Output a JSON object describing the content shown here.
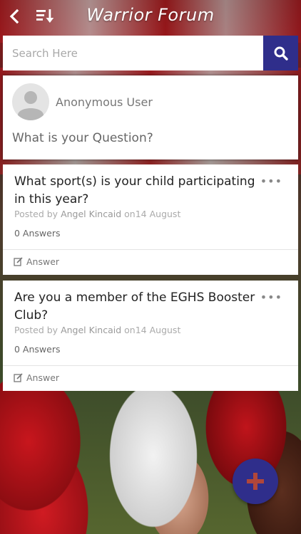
{
  "header": {
    "title": "Warrior Forum",
    "back_icon": "back-arrow-icon",
    "sort_icon": "sort-icon"
  },
  "search": {
    "placeholder": "Search Here",
    "value": "",
    "button_icon": "search-icon"
  },
  "ask": {
    "user_name": "Anonymous User",
    "prompt": "What is your Question?"
  },
  "questions": [
    {
      "title": "What sport(s) is your child participating in this year?",
      "posted_by_label": "Posted by",
      "author": "Angel Kincaid",
      "on_label": "on",
      "date": "14 August",
      "answers_count": "0 Answers",
      "answer_label": "Answer"
    },
    {
      "title": "Are you a member of the EGHS Booster Club?",
      "posted_by_label": "Posted by",
      "author": "Angel Kincaid",
      "on_label": "on",
      "date": "14 August",
      "answers_count": "0 Answers",
      "answer_label": "Answer"
    }
  ],
  "fab": {
    "icon": "plus-icon"
  },
  "colors": {
    "accent": "#2f2e8b",
    "fab_plus": "#b0463a"
  }
}
